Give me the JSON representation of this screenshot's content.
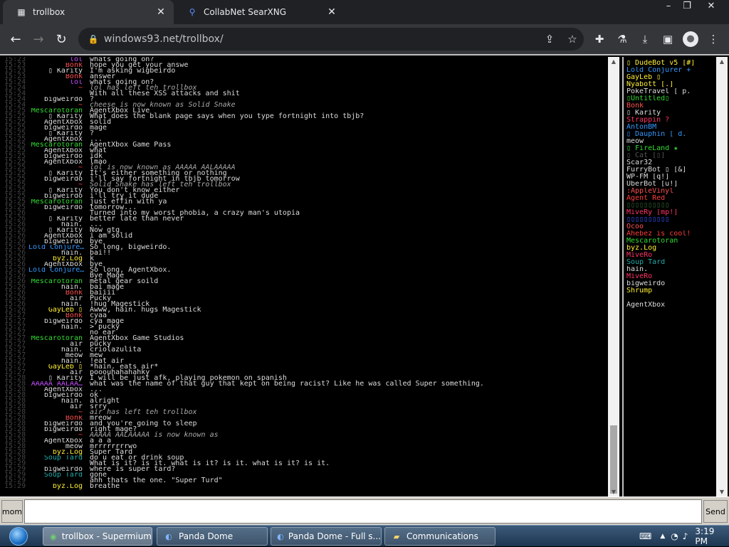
{
  "browser": {
    "tabs": [
      {
        "title": "trollbox",
        "active": true
      },
      {
        "title": "CollabNet SearXNG",
        "active": false
      }
    ],
    "url": "windows93.net/trollbox/",
    "window_controls": [
      "–",
      "❐",
      "✕"
    ]
  },
  "messages": [
    {
      "time": "15:23",
      "nick": "lol",
      "nick_color": "#c44dff",
      "text": "whats going on?",
      "system": false
    },
    {
      "time": "15:23",
      "nick": "Bonk",
      "nick_color": "#ff5050",
      "text": "hope you get your answe",
      "system": false
    },
    {
      "time": "15:23",
      "nick": "▯ Karity",
      "nick_color": "#dddddd",
      "text": "I'm asking wigbeirdo",
      "system": false
    },
    {
      "time": "15:23",
      "nick": "Bonk",
      "nick_color": "#ff5050",
      "text": "answer",
      "system": false
    },
    {
      "time": "15:24",
      "nick": "lol",
      "nick_color": "#c44dff",
      "text": "whats going on?",
      "system": false
    },
    {
      "time": "15:24",
      "nick": "~",
      "nick_color": "#ff3b3b",
      "text": "lol has left teh trollbox",
      "system": true
    },
    {
      "time": "15:24",
      "nick": "",
      "nick_color": "#3355ff",
      "text": "With all these XSS attacks and shit",
      "system": false
    },
    {
      "time": "15:24",
      "nick": "bigweirdo",
      "nick_color": "#dddddd",
      "text": "?",
      "system": false
    },
    {
      "time": "15:24",
      "nick": "~",
      "nick_color": "#ff3b3b",
      "text": "cheese is now known as Solid Snake",
      "system": true
    },
    {
      "time": "15:25",
      "nick": "Mescarotoran",
      "nick_color": "#33dd33",
      "text": "AgentXbox Live",
      "system": false
    },
    {
      "time": "15:25",
      "nick": "▯ Karity",
      "nick_color": "#dddddd",
      "text": "What does the blank page says when you type fortnight into tbjb?",
      "system": false
    },
    {
      "time": "15:25",
      "nick": "AgentXbox",
      "nick_color": "#dddddd",
      "text": "solid",
      "system": false
    },
    {
      "time": "15:25",
      "nick": "bigweirdo",
      "nick_color": "#dddddd",
      "text": "mage",
      "system": false
    },
    {
      "time": "15:25",
      "nick": "▯ Karity",
      "nick_color": "#dddddd",
      "text": "?",
      "system": false
    },
    {
      "time": "15:25",
      "nick": "AgentXbox",
      "nick_color": "#dddddd",
      "text": "...",
      "system": false
    },
    {
      "time": "15:25",
      "nick": "Mescarotoran",
      "nick_color": "#33dd33",
      "text": "AgentXbox Game Pass",
      "system": false
    },
    {
      "time": "15:25",
      "nick": "AgentXbox",
      "nick_color": "#dddddd",
      "text": "what",
      "system": false
    },
    {
      "time": "15:25",
      "nick": "bigweirdo",
      "nick_color": "#dddddd",
      "text": "idk",
      "system": false
    },
    {
      "time": "15:25",
      "nick": "AgentXbox",
      "nick_color": "#dddddd",
      "text": "lmao",
      "system": false
    },
    {
      "time": "15:25",
      "nick": "~",
      "nick_color": "#ff3b3b",
      "text": "lol is now known as AAAAA AALAAAAA",
      "system": true
    },
    {
      "time": "15:25",
      "nick": "▯ Karity",
      "nick_color": "#dddddd",
      "text": "It's either something or nothing",
      "system": false
    },
    {
      "time": "15:25",
      "nick": "bigweirdo",
      "nick_color": "#dddddd",
      "text": "i'll say fortnight in tbjb tomorrow",
      "system": false
    },
    {
      "time": "15:25",
      "nick": "~",
      "nick_color": "#ff3b3b",
      "text": "Solid Snake has left teh trollbox",
      "system": true
    },
    {
      "time": "15:25",
      "nick": "▯ Karity",
      "nick_color": "#dddddd",
      "text": "You don't know either",
      "system": false
    },
    {
      "time": "15:25",
      "nick": "bigweirdo",
      "nick_color": "#dddddd",
      "text": "i'll try it dude",
      "system": false
    },
    {
      "time": "15:25",
      "nick": "Mescarotoran",
      "nick_color": "#33dd33",
      "text": "just effin with ya",
      "system": false
    },
    {
      "time": "15:25",
      "nick": "bigweirdo",
      "nick_color": "#dddddd",
      "text": "tomorrow...",
      "system": false
    },
    {
      "time": "15:26",
      "nick": "",
      "nick_color": "#3355ff",
      "text": "Turned into my worst phobia, a crazy man's utopia",
      "system": false
    },
    {
      "time": "15:26",
      "nick": "▯ Karity",
      "nick_color": "#dddddd",
      "text": "better late than never",
      "system": false
    },
    {
      "time": "15:26",
      "nick": "hain.",
      "nick_color": "#dddddd",
      "text": "...",
      "system": false
    },
    {
      "time": "15:26",
      "nick": "▯ Karity",
      "nick_color": "#dddddd",
      "text": "Now gtg",
      "system": false
    },
    {
      "time": "15:26",
      "nick": "AgentXbox",
      "nick_color": "#dddddd",
      "text": "i am solid",
      "system": false
    },
    {
      "time": "15:26",
      "nick": "bigweirdo",
      "nick_color": "#dddddd",
      "text": "bye",
      "system": false
    },
    {
      "time": "15:26",
      "nick": "Lold Conjure…",
      "nick_color": "#3399ff",
      "text": "So long, bigweirdo.",
      "system": false
    },
    {
      "time": "15:26",
      "nick": "hain.",
      "nick_color": "#dddddd",
      "text": "bai!!",
      "system": false
    },
    {
      "time": "15:26",
      "nick": "byz.Log",
      "nick_color": "#ffee33",
      "text": "k",
      "system": false
    },
    {
      "time": "15:26",
      "nick": "AgentXbox",
      "nick_color": "#dddddd",
      "text": "bye",
      "system": false
    },
    {
      "time": "15:26",
      "nick": "Lold Conjure…",
      "nick_color": "#3399ff",
      "text": "So long, AgentXbox.",
      "system": false
    },
    {
      "time": "15:26",
      "nick": "",
      "nick_color": "#3355ff",
      "text": "Bye Mage",
      "system": false
    },
    {
      "time": "15:26",
      "nick": "Mescarotoran",
      "nick_color": "#33dd33",
      "text": "metal gear soild",
      "system": false
    },
    {
      "time": "15:26",
      "nick": "hain.",
      "nick_color": "#dddddd",
      "text": "bai mage",
      "system": false
    },
    {
      "time": "15:26",
      "nick": "Bonk",
      "nick_color": "#ff5050",
      "text": "baiiii",
      "system": false
    },
    {
      "time": "15:26",
      "nick": "air",
      "nick_color": "#dddddd",
      "text": "Pucky",
      "system": false
    },
    {
      "time": "15:26",
      "nick": "hain.",
      "nick_color": "#dddddd",
      "text": "!hug Magestick",
      "system": false
    },
    {
      "time": "15:26",
      "nick": "GayLeb ▯",
      "nick_color": "#ffee33",
      "text": "Awww, hain. hugs Magestick",
      "system": false
    },
    {
      "time": "15:27",
      "nick": "Bonk",
      "nick_color": "#ff5050",
      "text": "cyaa",
      "system": false
    },
    {
      "time": "15:27",
      "nick": "bigweirdo",
      "nick_color": "#dddddd",
      "text": "cya mage",
      "system": false
    },
    {
      "time": "15:27",
      "nick": "hain.",
      "nick_color": "#dddddd",
      "text": "> pucky",
      "system": false
    },
    {
      "time": "15:27",
      "nick": "",
      "nick_color": "#dddddd",
      "text": "no ear",
      "system": false
    },
    {
      "time": "15:27",
      "nick": "Mescarotoran",
      "nick_color": "#33dd33",
      "text": "AgentXbox Game Studios",
      "system": false
    },
    {
      "time": "15:27",
      "nick": "air",
      "nick_color": "#dddddd",
      "text": "pucky",
      "system": false
    },
    {
      "time": "15:27",
      "nick": "hain.",
      "nick_color": "#dddddd",
      "text": "criolazulita",
      "system": false
    },
    {
      "time": "15:27",
      "nick": "meow",
      "nick_color": "#dddddd",
      "text": "mew",
      "system": false
    },
    {
      "time": "15:27",
      "nick": "hain.",
      "nick_color": "#dddddd",
      "text": "!eat air",
      "system": false
    },
    {
      "time": "15:27",
      "nick": "GayLeb ▯",
      "nick_color": "#ffee33",
      "text": "*hain. eats air*",
      "system": false
    },
    {
      "time": "15:27",
      "nick": "air",
      "nick_color": "#dddddd",
      "text": "pooouhahahahky",
      "system": false
    },
    {
      "time": "15:28",
      "nick": "▯ Karity",
      "nick_color": "#dddddd",
      "text": "I will be just afk, playing pokemon on spanish",
      "system": false
    },
    {
      "time": "15:28",
      "nick": "AAAAA AALAA…",
      "nick_color": "#c44dff",
      "text": "what was the name of that guy that kept on being racist? Like he was called Super something.",
      "system": false
    },
    {
      "time": "15:28",
      "nick": "AgentXbox",
      "nick_color": "#dddddd",
      "text": "...",
      "system": false
    },
    {
      "time": "15:28",
      "nick": "bigweirdo",
      "nick_color": "#dddddd",
      "text": "ok",
      "system": false
    },
    {
      "time": "15:28",
      "nick": "hain.",
      "nick_color": "#dddddd",
      "text": "alright",
      "system": false
    },
    {
      "time": "15:28",
      "nick": "air",
      "nick_color": "#dddddd",
      "text": "srry",
      "system": false
    },
    {
      "time": "15:28",
      "nick": "~",
      "nick_color": "#ff3b3b",
      "text": "air has left teh trollbox",
      "system": true
    },
    {
      "time": "15:28",
      "nick": "Bonk",
      "nick_color": "#ff5050",
      "text": "mreow",
      "system": false
    },
    {
      "time": "15:28",
      "nick": "bigweirdo",
      "nick_color": "#dddddd",
      "text": "and you're going to sleep",
      "system": false
    },
    {
      "time": "15:28",
      "nick": "bigweirdo",
      "nick_color": "#dddddd",
      "text": "right mage?",
      "system": false
    },
    {
      "time": "15:28",
      "nick": "~",
      "nick_color": "#ff3b3b",
      "text": "AAAAA AALAAAAA is now known as",
      "system": true
    },
    {
      "time": "15:28",
      "nick": "AgentXbox",
      "nick_color": "#dddddd",
      "text": "a a a",
      "system": false
    },
    {
      "time": "15:28",
      "nick": "meow",
      "nick_color": "#dddddd",
      "text": "mrrrrrrrrwo",
      "system": false
    },
    {
      "time": "15:28",
      "nick": "byz.Log",
      "nick_color": "#ffee33",
      "text": "Super Tard",
      "system": false
    },
    {
      "time": "15:28",
      "nick": "Soup Tard",
      "nick_color": "#22aaaa",
      "text": "do u eat or drink soup",
      "system": false
    },
    {
      "time": "15:29",
      "nick": "",
      "nick_color": "#3355ff",
      "text": "What is it? is it. what is it? is it. what is it? is it.",
      "system": false
    },
    {
      "time": "15:29",
      "nick": "bigweirdo",
      "nick_color": "#dddddd",
      "text": "where is super tard?",
      "system": false
    },
    {
      "time": "15:29",
      "nick": "Soup Tard",
      "nick_color": "#22aaaa",
      "text": "gone",
      "system": false
    },
    {
      "time": "15:29",
      "nick": "",
      "nick_color": "#dddddd",
      "text": "ahh thats the one. \"Super Turd\"",
      "system": false
    },
    {
      "time": "15:29",
      "nick": "byz.Log",
      "nick_color": "#ffee33",
      "text": "breathe",
      "system": false
    }
  ],
  "users": [
    {
      "name": "▯ DudeBot v5 [#]",
      "color": "#ffee33"
    },
    {
      "name": "Lold Conjurer +",
      "color": "#3399ff"
    },
    {
      "name": "GayLeb ▯",
      "color": "#ffee33"
    },
    {
      "name": "Nyabott [.]",
      "color": "#ffee33"
    },
    {
      "name": "PokeTravel [ p.",
      "color": "#dddddd"
    },
    {
      "name": "▯Untitled▯",
      "color": "#33dd33"
    },
    {
      "name": "Bonk",
      "color": "#ff5050"
    },
    {
      "name": "▯ Karity",
      "color": "#dddddd"
    },
    {
      "name": "Strappin ?",
      "color": "#ff3366"
    },
    {
      "name": "AntonBM",
      "color": "#3399ff"
    },
    {
      "name": "▯ Dauphin [ d.",
      "color": "#3399ff"
    },
    {
      "name": "meow",
      "color": "#dddddd"
    },
    {
      "name": "▯ FireLand ★",
      "color": "#33dd33"
    },
    {
      "name": "▯ Cat [▯]",
      "color": "#555555"
    },
    {
      "name": "Scar32",
      "color": "#dddddd"
    },
    {
      "name": "FurryBot ▯ [&]",
      "color": "#dddddd"
    },
    {
      "name": "WP-FM [q!]",
      "color": "#dddddd"
    },
    {
      "name": "UberBot [u!]",
      "color": "#dddddd"
    },
    {
      "name": ":AppleVinyl",
      "color": "#ff5050"
    },
    {
      "name": "Agent Red",
      "color": "#ff3b3b"
    },
    {
      "name": "▯▯▯▯▯▯▯▯▯▯",
      "color": "#336633"
    },
    {
      "name": "MiveRy [mp!]",
      "color": "#ff3366"
    },
    {
      "name": "▯▯▯▯▯▯▯▯▯▯",
      "color": "#3355ff"
    },
    {
      "name": "Ocoo",
      "color": "#ff5050"
    },
    {
      "name": "Ahebez is cool!",
      "color": "#ff3b3b"
    },
    {
      "name": "Mescarotoran",
      "color": "#33dd33"
    },
    {
      "name": "byz.Log",
      "color": "#ffee33"
    },
    {
      "name": "MiveRo",
      "color": "#ff3366"
    },
    {
      "name": "Soup Tard",
      "color": "#22aaaa"
    },
    {
      "name": "hain.",
      "color": "#dddddd"
    },
    {
      "name": "MiveRo",
      "color": "#ff3366"
    },
    {
      "name": "bigweirdo",
      "color": "#dddddd"
    },
    {
      "name": "Shrump",
      "color": "#ffee33"
    },
    {
      "name": "",
      "color": "#dddddd"
    },
    {
      "name": "AgentXbox",
      "color": "#dddddd"
    }
  ],
  "input": {
    "nick_button": "mom",
    "value": "",
    "send_label": "Send"
  },
  "taskbar": {
    "items": [
      {
        "label": "trollbox - Supermium",
        "active": true,
        "icon": "browser-icon"
      },
      {
        "label": "Panda Dome",
        "active": false,
        "icon": "panda-icon"
      },
      {
        "label": "Panda Dome - Full s...",
        "active": false,
        "icon": "panda-icon"
      },
      {
        "label": "Communications",
        "active": false,
        "icon": "folder-icon"
      }
    ],
    "clock": "3:19 PM"
  }
}
